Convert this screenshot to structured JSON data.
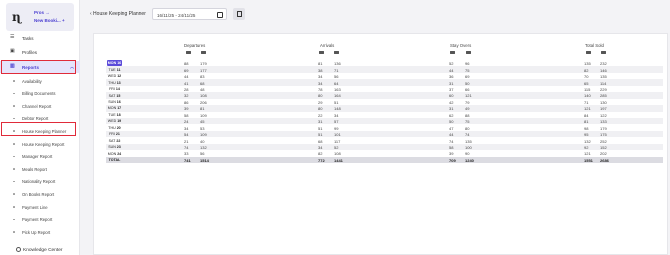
{
  "sidebar": {
    "logo_mark": "ɳ",
    "links": [
      "Pros →",
      "New Booki... +"
    ],
    "main": [
      {
        "label": "Tasks",
        "icon": "list-icon"
      },
      {
        "label": "Profiles",
        "icon": "profile-icon"
      },
      {
        "label": "Reports",
        "icon": "reports-icon"
      }
    ],
    "reports_submenu": [
      "Availability",
      "Billing Documents",
      "Channel Report",
      "Debtor Report",
      "House Keeping Planner",
      "House Keeping Report",
      "Manager Report",
      "Meals Report",
      "Nationality Report",
      "On Books Report",
      "Payment Line",
      "Payment Report",
      "Pick Up Report"
    ],
    "knowledge_center": "Knowledge Center"
  },
  "topbar": {
    "back_label": "‹ House Keeping Planner",
    "date_range": "16/11/25 - 24/11/25"
  },
  "table": {
    "groups": [
      "Departures",
      "Arrivals",
      "Stay Overs",
      "Total Sold"
    ],
    "rows": [
      {
        "wd": "MON",
        "d": "16",
        "v": [
          "88",
          "179",
          "81",
          "136",
          "52",
          "96",
          "135",
          "232"
        ],
        "selected": true
      },
      {
        "wd": "TUE",
        "d": "11",
        "v": [
          "69",
          "177",
          "38",
          "71",
          "44",
          "75",
          "82",
          "146"
        ]
      },
      {
        "wd": "WED",
        "d": "12",
        "v": [
          "44",
          "83",
          "34",
          "56",
          "36",
          "69",
          "70",
          "135"
        ]
      },
      {
        "wd": "THU",
        "d": "13",
        "v": [
          "41",
          "68",
          "34",
          "64",
          "31",
          "50",
          "65",
          "114"
        ]
      },
      {
        "wd": "FRI",
        "d": "14",
        "v": [
          "28",
          "48",
          "78",
          "163",
          "37",
          "66",
          "115",
          "229"
        ]
      },
      {
        "wd": "SAT",
        "d": "15",
        "v": [
          "32",
          "108",
          "80",
          "164",
          "60",
          "121",
          "140",
          "285"
        ]
      },
      {
        "wd": "SUN",
        "d": "16",
        "v": [
          "86",
          "206",
          "29",
          "51",
          "42",
          "79",
          "71",
          "130"
        ]
      },
      {
        "wd": "MON",
        "d": "17",
        "v": [
          "39",
          "81",
          "80",
          "148",
          "31",
          "49",
          "121",
          "197"
        ]
      },
      {
        "wd": "TUE",
        "d": "18",
        "v": [
          "58",
          "109",
          "22",
          "34",
          "62",
          "88",
          "84",
          "122"
        ]
      },
      {
        "wd": "WED",
        "d": "19",
        "v": [
          "24",
          "45",
          "31",
          "57",
          "50",
          "75",
          "81",
          "133"
        ]
      },
      {
        "wd": "THU",
        "d": "20",
        "v": [
          "34",
          "53",
          "51",
          "99",
          "47",
          "80",
          "98",
          "179"
        ]
      },
      {
        "wd": "FRI",
        "d": "21",
        "v": [
          "54",
          "109",
          "51",
          "101",
          "44",
          "74",
          "95",
          "175"
        ]
      },
      {
        "wd": "SAT",
        "d": "22",
        "v": [
          "21",
          "40",
          "68",
          "117",
          "74",
          "135",
          "132",
          "252"
        ]
      },
      {
        "wd": "SUN",
        "d": "23",
        "v": [
          "74",
          "132",
          "34",
          "52",
          "58",
          "100",
          "92",
          "152"
        ]
      },
      {
        "wd": "MON",
        "d": "24",
        "v": [
          "33",
          "56",
          "82",
          "108",
          "39",
          "90",
          "121",
          "202"
        ]
      }
    ],
    "total": {
      "label": "TOTAL",
      "v": [
        "741",
        "1514",
        "772",
        "1441",
        "709",
        "1240",
        "1551",
        "2686"
      ]
    }
  }
}
